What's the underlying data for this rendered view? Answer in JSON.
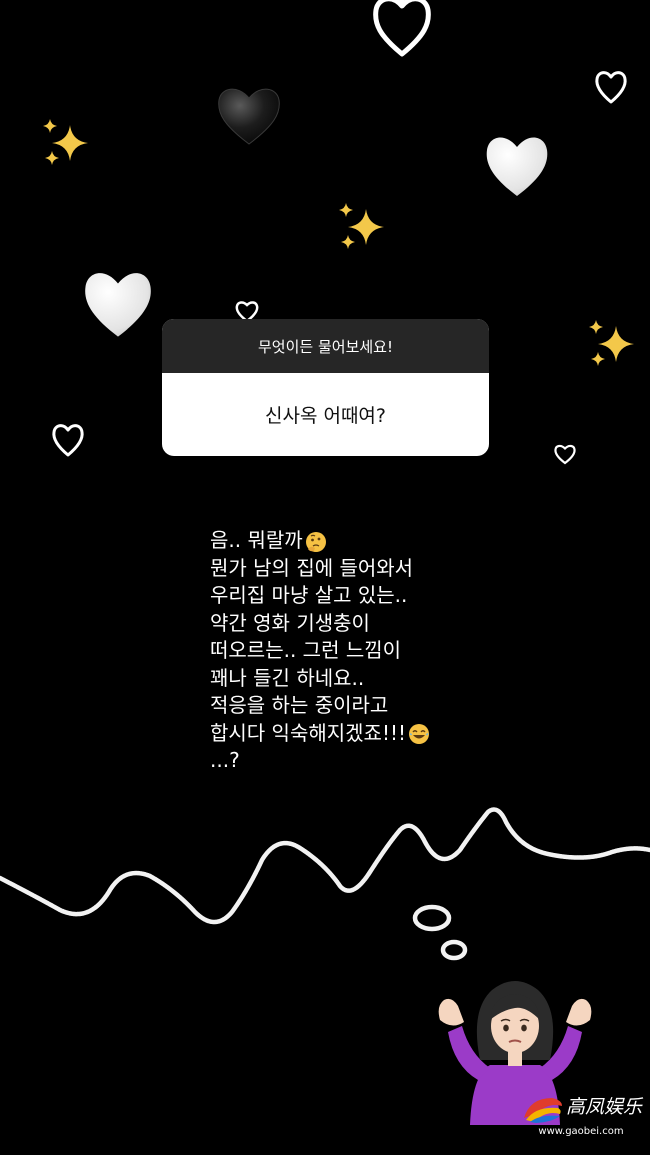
{
  "question_box": {
    "prompt": "무엇이든 물어보세요!",
    "question": "신사옥 어때여?"
  },
  "reply": {
    "lines": [
      "음.. 뭐랄까",
      "뭔가 남의 집에 들어와서",
      "우리집 마냥 살고 있는..",
      "약간 영화 기생충이",
      "떠오르는.. 그런 느낌이",
      "꽤나 들긴 하네요..",
      "적응을 하는 중이라고",
      "합시다 익숙해지겠죠!!!",
      "...?"
    ],
    "emojis": [
      "thinking-face-emoji",
      "tears-of-joy-emoji"
    ]
  },
  "stickers": [
    "white-heart-icon",
    "black-heart-icon",
    "sparkles-icon",
    "heart-outline-icon",
    "shrugging-woman-emoji",
    "thought-bubble-doodle"
  ],
  "watermark": {
    "brand_text": "高凤娱乐",
    "url": "www.gaobei.com"
  },
  "colors": {
    "background": "#000000",
    "question_header": "#262626",
    "question_body": "#ffffff",
    "sparkle": "#f3c84a",
    "heart_white": "#e8e8e8"
  }
}
